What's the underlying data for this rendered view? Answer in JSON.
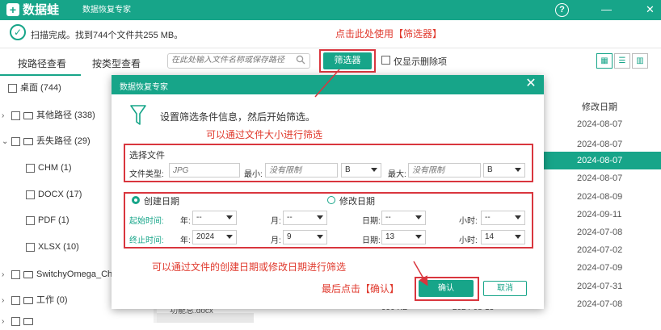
{
  "titlebar": {
    "logo_text": "数据蛙",
    "app_name": "数据恢复专家",
    "help": "?",
    "min": "—",
    "close": "✕"
  },
  "toolbar": {
    "scan_status": "扫描完成。找到744个文件共255 MB。",
    "tip_filter": "点击此处使用【筛选器】",
    "search_placeholder": "在此处输入文件名称或保存路径",
    "filter_button": "筛选器",
    "only_deleted": "仅显示删除项"
  },
  "tabs": {
    "by_path": "按路径查看",
    "by_type": "按类型查看"
  },
  "tree": [
    {
      "label": "桌面 (744)",
      "arrow": ""
    },
    {
      "label": "其他路径 (338)",
      "arrow": ">"
    },
    {
      "label": "丢失路径 (29)",
      "arrow": "v"
    },
    {
      "label": "CHM (1)",
      "arrow": ""
    },
    {
      "label": "DOCX (17)",
      "arrow": ""
    },
    {
      "label": "PDF (1)",
      "arrow": ""
    },
    {
      "label": "XLSX (10)",
      "arrow": ""
    },
    {
      "label": "SwitchyOmega_Ch",
      "arrow": ">"
    },
    {
      "label": "工作 (0)",
      "arrow": ">"
    },
    {
      "label": "",
      "arrow": ">"
    }
  ],
  "file_list": {
    "date_header": "修改日期",
    "dates": [
      "2024-08-07",
      "2024-08-07",
      "2024-08-07",
      "2024-08-07",
      "2024-08-09",
      "2024-09-11",
      "2024-07-08",
      "2024-07-02",
      "2024-07-09",
      "2024-07-31",
      "2024-07-08",
      "2024-09-11"
    ],
    "hidden_row": {
      "name": "功能总.docx",
      "size": "990 KB",
      "date": "2024-08-13"
    }
  },
  "dialog": {
    "title": "数据恢复专家",
    "intro": "设置筛选条件信息，然后开始筛选。",
    "tip_size": "可以通过文件大小进行筛选",
    "select_file": "选择文件",
    "file_type_label": "文件类型:",
    "file_type_placeholder": "JPG",
    "min_label": "最小:",
    "min_placeholder": "没有限制",
    "min_unit": "B",
    "max_label": "最大:",
    "max_placeholder": "没有限制",
    "max_unit": "B",
    "create_date": "创建日期",
    "modify_date": "修改日期",
    "start_label": "起始时间:",
    "end_label": "终止时间:",
    "year_label": "年:",
    "month_label": "月:",
    "day_label": "日期:",
    "hour_label": "小时:",
    "start": {
      "year": "--",
      "month": "--",
      "day": "--",
      "hour": "--"
    },
    "end": {
      "year": "2024",
      "month": "9",
      "day": "13",
      "hour": "14"
    },
    "tip_date": "可以通过文件的创建日期或修改日期进行筛选",
    "tip_confirm": "最后点击【确认】",
    "ok": "确认",
    "cancel": "取消"
  },
  "colors": {
    "accent": "#17a589",
    "highlight": "#d9363e",
    "tip": "#e03a2e"
  }
}
